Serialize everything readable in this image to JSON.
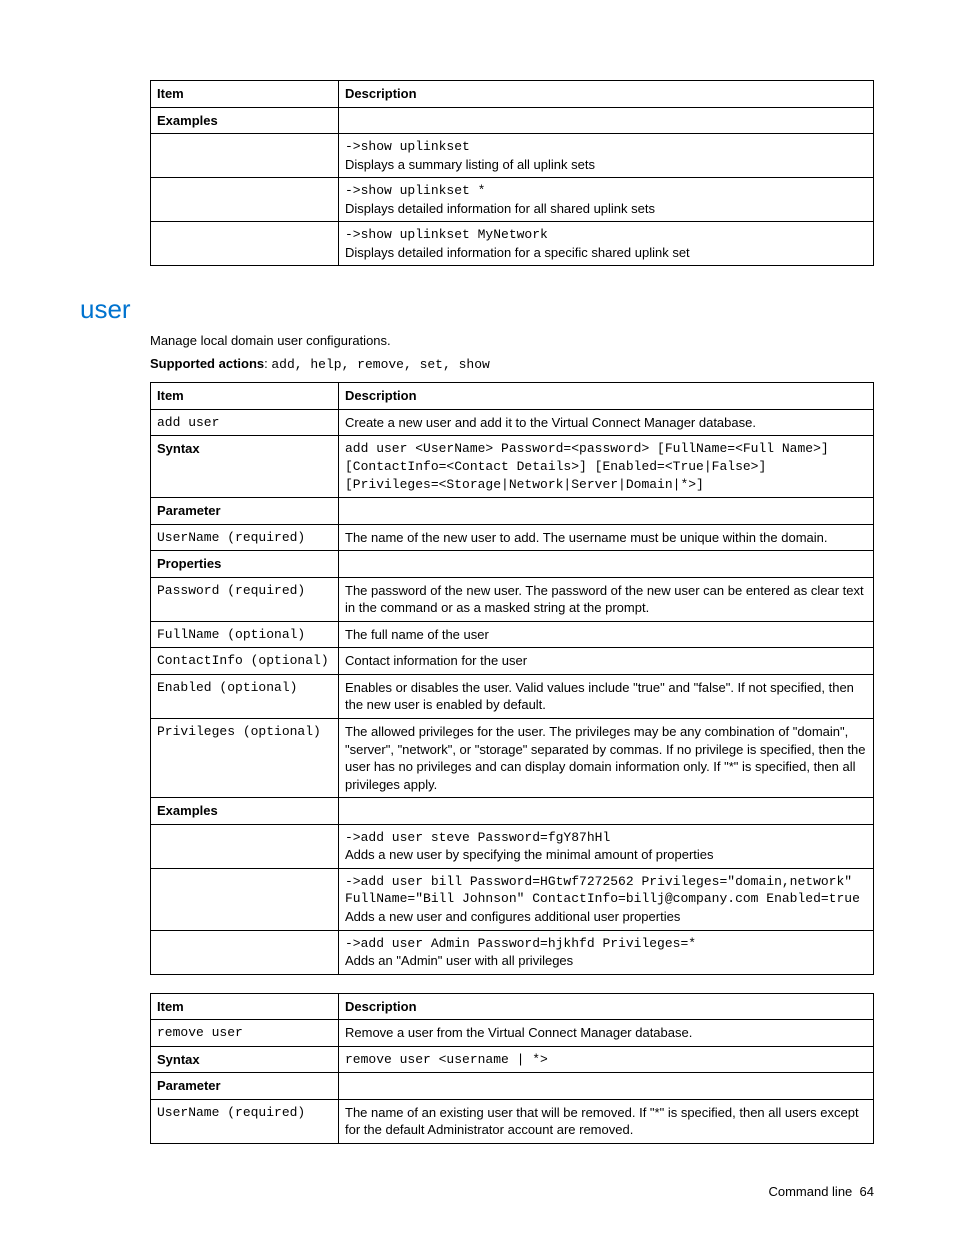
{
  "table1": {
    "header": {
      "item": "Item",
      "desc": "Description"
    },
    "rows": [
      {
        "item_bold": true,
        "item_text": "Examples",
        "desc_mono": "",
        "desc_text": ""
      },
      {
        "item_text": "",
        "desc_mono": "->show uplinkset",
        "desc_text": "Displays a summary listing of all uplink sets"
      },
      {
        "item_text": "",
        "desc_mono": "->show uplinkset *",
        "desc_text": "Displays detailed information for all shared uplink sets"
      },
      {
        "item_text": "",
        "desc_mono": "->show uplinkset MyNetwork",
        "desc_text": "Displays detailed information for a specific shared uplink set"
      }
    ]
  },
  "user_section": {
    "title": "user",
    "intro": "Manage local domain user configurations.",
    "supported_label": "Supported actions",
    "supported_actions": "add, help, remove, set, show"
  },
  "table2": {
    "header": {
      "item": "Item",
      "desc": "Description"
    },
    "rows": [
      {
        "item_mono": true,
        "item_text": "add user",
        "desc_text": "Create a new user and add it to the Virtual Connect Manager database."
      },
      {
        "item_bold": true,
        "item_text": "Syntax",
        "desc_mono": "add user <UserName> Password=<password> [FullName=<Full Name>] [ContactInfo=<Contact Details>] [Enabled=<True|False>] [Privileges=<Storage|Network|Server|Domain|*>]",
        "desc_text": ""
      },
      {
        "item_bold": true,
        "item_text": "Parameter",
        "desc_text": ""
      },
      {
        "item_mono": true,
        "item_text": "UserName (required)",
        "desc_text": "The name of the new user to add. The username must be unique within the domain."
      },
      {
        "item_bold": true,
        "item_text": "Properties",
        "desc_text": ""
      },
      {
        "item_mono": true,
        "item_text": "Password (required)",
        "desc_text": "The password of the new user. The password of the new user can be entered as clear text in the command or as a masked string at the prompt."
      },
      {
        "item_mono": true,
        "item_text": "FullName (optional)",
        "desc_text": "The full name of the user"
      },
      {
        "item_mono": true,
        "item_text": "ContactInfo (optional)",
        "desc_text": "Contact information for the user"
      },
      {
        "item_mono": true,
        "item_text": "Enabled (optional)",
        "desc_text": "Enables or disables the user. Valid values include \"true\" and \"false\". If not specified, then the new user is enabled by default."
      },
      {
        "item_mono": true,
        "item_text": "Privileges (optional)",
        "desc_text": "The allowed privileges for the user. The privileges may be any combination of \"domain\", \"server\", \"network\", or \"storage\" separated by commas. If no privilege is specified, then the user has no privileges and can display domain information only. If \"*\" is specified, then all privileges apply."
      },
      {
        "item_bold": true,
        "item_text": "Examples",
        "desc_text": ""
      },
      {
        "item_text": "",
        "desc_mono": "->add user steve Password=fgY87hHl",
        "desc_text": "Adds a new user by specifying the minimal amount of properties"
      },
      {
        "item_text": "",
        "desc_mono": "->add user bill Password=HGtwf7272562 Privileges=\"domain,network\" FullName=\"Bill Johnson\" ContactInfo=billj@company.com Enabled=true",
        "desc_text": "Adds a new user and configures additional user properties"
      },
      {
        "item_text": "",
        "desc_mono": "->add user Admin Password=hjkhfd Privileges=*",
        "desc_text": "Adds an \"Admin\" user with all privileges"
      }
    ]
  },
  "table3": {
    "header": {
      "item": "Item",
      "desc": "Description"
    },
    "rows": [
      {
        "item_mono": true,
        "item_text": "remove user",
        "desc_text": "Remove a user from the Virtual Connect Manager database."
      },
      {
        "item_bold": true,
        "item_text": "Syntax",
        "desc_mono": "remove user <username | *>",
        "desc_text": ""
      },
      {
        "item_bold": true,
        "item_text": "Parameter",
        "desc_text": ""
      },
      {
        "item_mono": true,
        "item_text": "UserName (required)",
        "desc_text": "The name of an existing user that will be removed. If \"*\" is specified, then all users except for the default Administrator account are removed."
      }
    ]
  },
  "footer": {
    "label": "Command line",
    "page": "64"
  }
}
